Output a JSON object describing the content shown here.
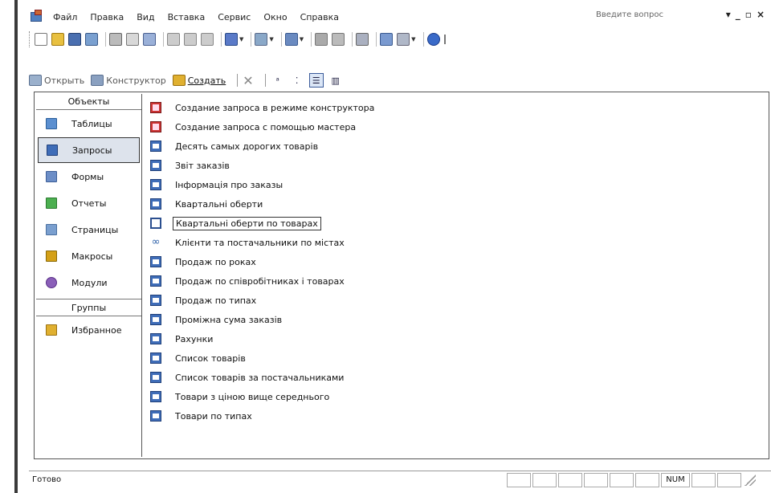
{
  "menubar": {
    "items": [
      {
        "label": "Файл"
      },
      {
        "label": "Правка"
      },
      {
        "label": "Вид"
      },
      {
        "label": "Вставка"
      },
      {
        "label": "Сервис"
      },
      {
        "label": "Окно"
      },
      {
        "label": "Справка"
      }
    ],
    "help_placeholder": "Введите вопрос",
    "ctrl_minimize": "_",
    "ctrl_restore": "▫",
    "ctrl_close": "×",
    "ctrl_dropdown": "▾"
  },
  "db_toolbar": {
    "open_label": "Открыть",
    "design_label": "Конструктор",
    "create_label": "Создать",
    "delete_symbol": "✕"
  },
  "objects": {
    "header": "Объекты",
    "items": [
      {
        "label": "Таблицы",
        "color": "#5b8fd0"
      },
      {
        "label": "Запросы",
        "color": "#3f6db8",
        "selected": true
      },
      {
        "label": "Формы",
        "color": "#6c8ec7"
      },
      {
        "label": "Отчеты",
        "color": "#4caf50"
      },
      {
        "label": "Страницы",
        "color": "#7a9fcf"
      },
      {
        "label": "Макросы",
        "color": "#d4a017"
      },
      {
        "label": "Модули",
        "color": "#8a5fb8"
      }
    ],
    "groups_header": "Группы",
    "groups": [
      {
        "label": "Избранное",
        "color": "#e0b030"
      }
    ]
  },
  "queries": [
    {
      "label": "Создание запроса в режиме конструктора",
      "icon": "wizard"
    },
    {
      "label": "Создание запроса с помощью мастера",
      "icon": "wizard"
    },
    {
      "label": "Десять самых дорогих товарів",
      "icon": "query"
    },
    {
      "label": "Звіт заказів",
      "icon": "query"
    },
    {
      "label": "Інформація про заказы",
      "icon": "query"
    },
    {
      "label": "Квартальні оберти",
      "icon": "query"
    },
    {
      "label": "Квартальні оберти по товарах",
      "icon": "crosstab",
      "focus": true
    },
    {
      "label": "Клієнти та постачальники по містах",
      "icon": "union"
    },
    {
      "label": "Продаж по роках",
      "icon": "query"
    },
    {
      "label": "Продаж по співробітниках і товарах",
      "icon": "query"
    },
    {
      "label": "Продаж по типах",
      "icon": "query"
    },
    {
      "label": "Проміжна сума заказів",
      "icon": "query"
    },
    {
      "label": "Рахунки",
      "icon": "query"
    },
    {
      "label": "Список товарів",
      "icon": "query"
    },
    {
      "label": "Список товарів за постачальниками",
      "icon": "query"
    },
    {
      "label": "Товари з ціною вище середнього",
      "icon": "query"
    },
    {
      "label": "Товари по типах",
      "icon": "query"
    }
  ],
  "statusbar": {
    "text": "Готово",
    "num": "NUM"
  }
}
